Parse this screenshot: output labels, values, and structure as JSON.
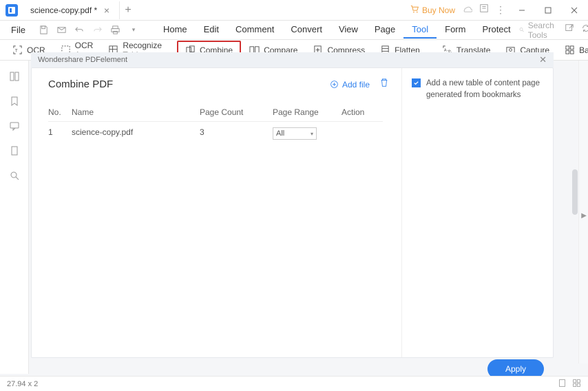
{
  "tab": {
    "title": "science-copy.pdf *"
  },
  "buyNow": "Buy Now",
  "menu": {
    "file": "File",
    "tabs": [
      "Home",
      "Edit",
      "Comment",
      "Convert",
      "View",
      "Page",
      "Tool",
      "Form",
      "Protect"
    ],
    "active": "Tool",
    "searchPlaceholder": "Search Tools"
  },
  "toolbar": {
    "ocr": "OCR",
    "ocrArea": "OCR Area",
    "recognizeTable": "Recognize Table",
    "combine": "Combine",
    "compare": "Compare",
    "compress": "Compress",
    "flatten": "Flatten",
    "translate": "Translate",
    "capture": "Capture",
    "ba": "Ba"
  },
  "dialog": {
    "header": "Wondershare PDFelement",
    "title": "Combine PDF",
    "addFile": "Add file",
    "columns": {
      "no": "No.",
      "name": "Name",
      "pageCount": "Page Count",
      "pageRange": "Page Range",
      "action": "Action"
    },
    "rows": [
      {
        "no": "1",
        "name": "science-copy.pdf",
        "pageCount": "3",
        "pageRange": "All"
      }
    ],
    "tocCheckbox": "Add a new table of content page generated from bookmarks",
    "apply": "Apply"
  },
  "status": {
    "dims": "27.94 x 2"
  }
}
